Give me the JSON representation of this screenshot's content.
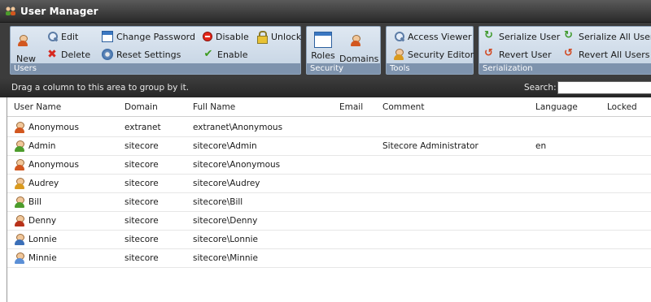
{
  "window": {
    "title": "User Manager"
  },
  "ribbon": {
    "users_group": {
      "caption": "Users",
      "new": "New",
      "edit": "Edit",
      "delete": "Delete",
      "change_password": "Change Password",
      "reset_settings": "Reset Settings",
      "disable": "Disable",
      "enable": "Enable",
      "unlock": "Unlock"
    },
    "security_group": {
      "caption": "Security",
      "roles": "Roles",
      "domains": "Domains"
    },
    "tools_group": {
      "caption": "Tools",
      "access_viewer": "Access Viewer",
      "security_editor": "Security Editor"
    },
    "serialization_group": {
      "caption": "Serialization",
      "serialize_user": "Serialize User",
      "serialize_all_users": "Serialize All Users",
      "revert_user": "Revert User",
      "revert_all_users": "Revert All Users"
    }
  },
  "grid": {
    "group_hint": "Drag a column to this area to group by it.",
    "search_label": "Search:",
    "search_value": "",
    "columns": [
      "User Name",
      "Domain",
      "Full Name",
      "Email",
      "Comment",
      "Language",
      "Locked"
    ],
    "rows": [
      {
        "user": "Anonymous",
        "domain": "extranet",
        "full": "extranet\\Anonymous",
        "email": "",
        "comment": "",
        "language": "",
        "locked": "",
        "icon_color": "#d2571f"
      },
      {
        "user": "Admin",
        "domain": "sitecore",
        "full": "sitecore\\Admin",
        "email": "",
        "comment": "Sitecore Administrator",
        "language": "en",
        "locked": "",
        "icon_color": "#4d9c2c"
      },
      {
        "user": "Anonymous",
        "domain": "sitecore",
        "full": "sitecore\\Anonymous",
        "email": "",
        "comment": "",
        "language": "",
        "locked": "",
        "icon_color": "#d2571f"
      },
      {
        "user": "Audrey",
        "domain": "sitecore",
        "full": "sitecore\\Audrey",
        "email": "",
        "comment": "",
        "language": "",
        "locked": "",
        "icon_color": "#d99a1f"
      },
      {
        "user": "Bill",
        "domain": "sitecore",
        "full": "sitecore\\Bill",
        "email": "",
        "comment": "",
        "language": "",
        "locked": "",
        "icon_color": "#4d9c2c"
      },
      {
        "user": "Denny",
        "domain": "sitecore",
        "full": "sitecore\\Denny",
        "email": "",
        "comment": "",
        "language": "",
        "locked": "",
        "icon_color": "#b8321a"
      },
      {
        "user": "Lonnie",
        "domain": "sitecore",
        "full": "sitecore\\Lonnie",
        "email": "",
        "comment": "",
        "language": "",
        "locked": "",
        "icon_color": "#3b6fb8"
      },
      {
        "user": "Minnie",
        "domain": "sitecore",
        "full": "sitecore\\Minnie",
        "email": "",
        "comment": "",
        "language": "",
        "locked": "",
        "icon_color": "#5b8fd6"
      }
    ]
  }
}
